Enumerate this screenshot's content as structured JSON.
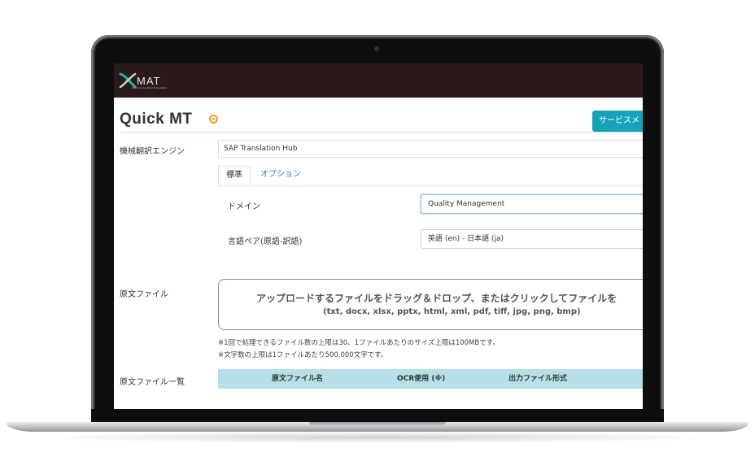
{
  "app": {
    "logo_text": "MAT",
    "logo_subtext": "Machine Assisted Translation",
    "page_title": "Quick MT",
    "service_button": "サービスメ"
  },
  "form": {
    "engine_label": "機械翻訳エンジン",
    "engine_value": "SAP Translation Hub",
    "tabs": [
      {
        "label": "標準"
      },
      {
        "label": "オプション"
      }
    ],
    "domain_label": "ドメイン",
    "domain_value": "Quality Management",
    "langpair_label": "言語ペア(原語-訳語)",
    "langpair_value": "英語 (en) - 日本語 (ja)",
    "source_file_label": "原文ファイル",
    "dropzone_main": "アップロードするファイルをドラッグ＆ドロップ、またはクリックしてファイルを",
    "dropzone_types": "(txt, docx, xlsx, pptx, html, xml, pdf, tiff, jpg, png, bmp)",
    "note_1": "※1回で処理できるファイル数の上限は30、1ファイルあたりのサイズ上限は100MBです。",
    "note_2": "※文字数の上限は1ファイルあたり500,000文字です。"
  },
  "table": {
    "label": "原文ファイル一覧",
    "columns": [
      "原文ファイル名",
      "OCR使用 (※)",
      "出力ファイル形式"
    ]
  },
  "colors": {
    "topbar": "#2a1a1a",
    "accent": "#17a2b8",
    "tab_link": "#2a7fc0",
    "table_header": "#b7dfe7"
  }
}
